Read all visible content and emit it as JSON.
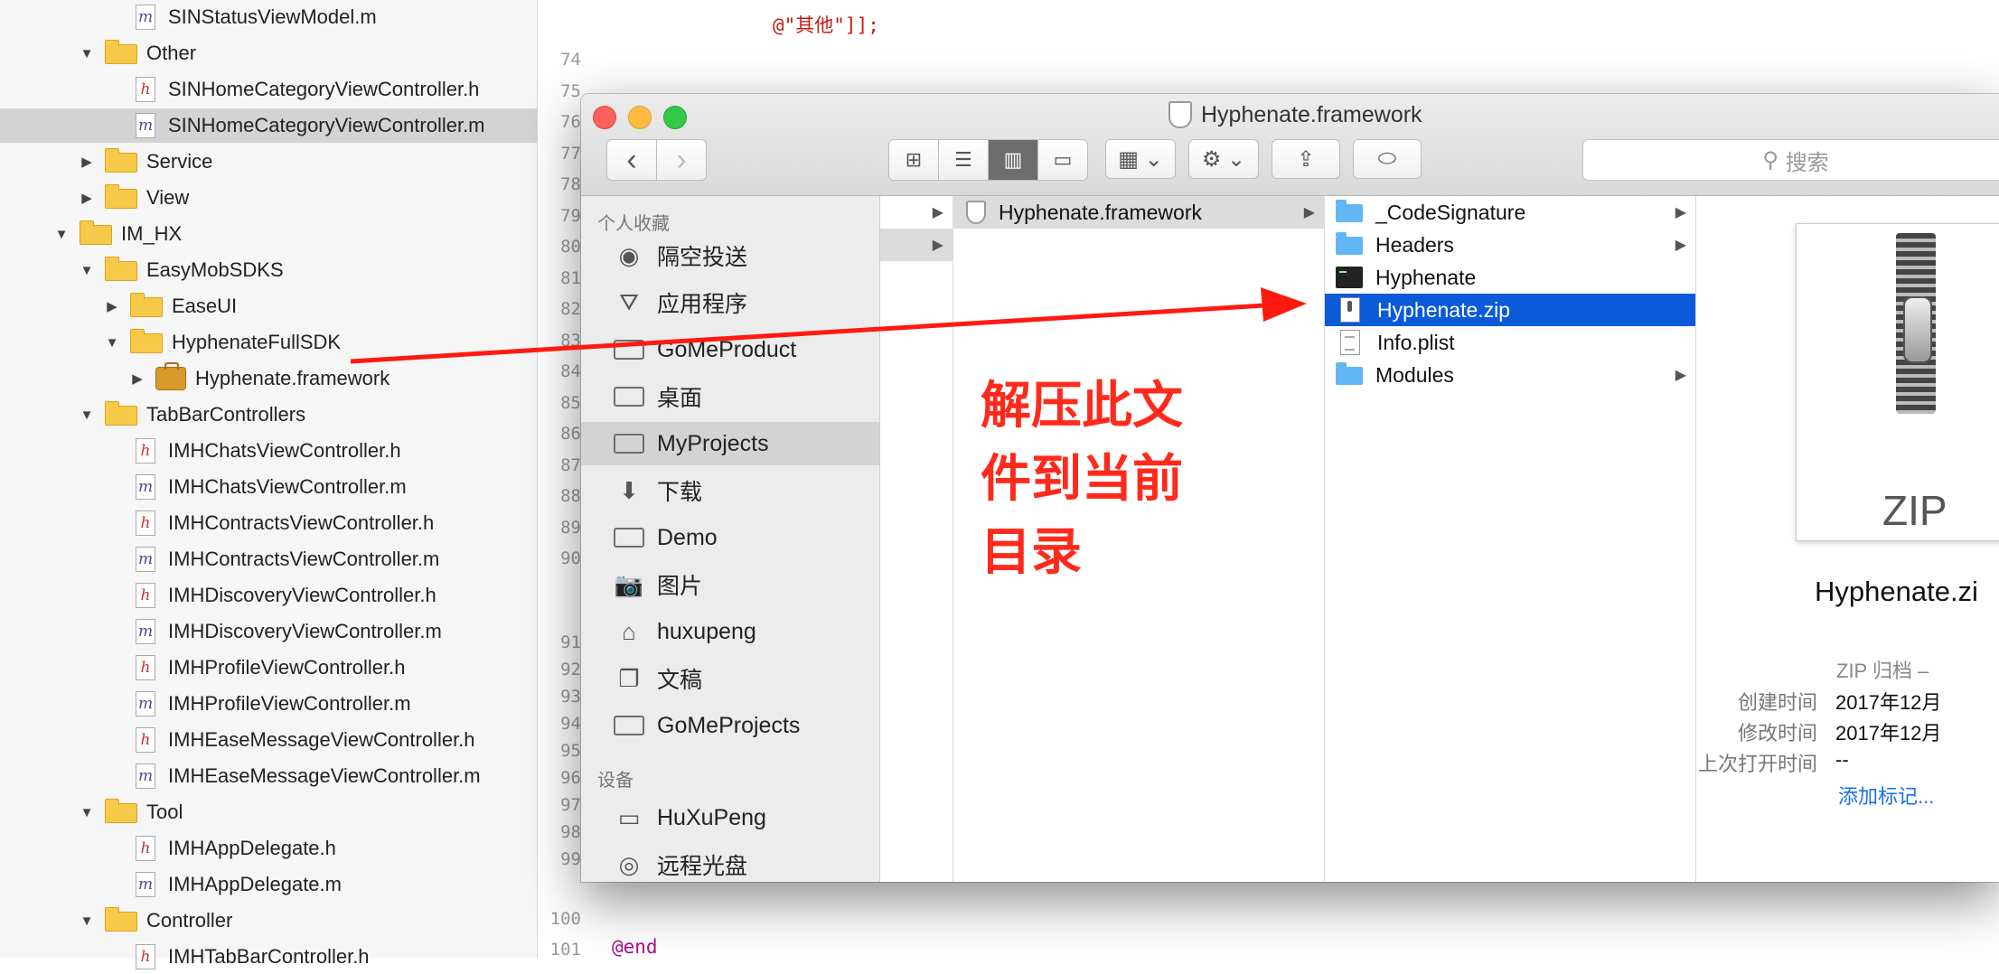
{
  "navigator": {
    "rows": [
      {
        "label": "SINStatusViewModel.m",
        "kind": "m",
        "disc": ""
      },
      {
        "label": "Other",
        "kind": "folder",
        "disc": "▼"
      },
      {
        "label": "SINHomeCategoryViewController.h",
        "kind": "h",
        "disc": ""
      },
      {
        "label": "SINHomeCategoryViewController.m",
        "kind": "m",
        "disc": "",
        "selected": true
      },
      {
        "label": "Service",
        "kind": "folder",
        "disc": "▶"
      },
      {
        "label": "View",
        "kind": "folder",
        "disc": "▶"
      },
      {
        "label": "IM_HX",
        "kind": "folder",
        "disc": "▼"
      },
      {
        "label": "EasyMobSDKS",
        "kind": "folder",
        "disc": "▼"
      },
      {
        "label": "EaseUI",
        "kind": "folder",
        "disc": "▶"
      },
      {
        "label": "HyphenateFullSDK",
        "kind": "folder",
        "disc": "▼"
      },
      {
        "label": "Hyphenate.framework",
        "kind": "fw",
        "disc": "▶"
      },
      {
        "label": "TabBarControllers",
        "kind": "folder",
        "disc": "▼"
      },
      {
        "label": "IMHChatsViewController.h",
        "kind": "h",
        "disc": ""
      },
      {
        "label": "IMHChatsViewController.m",
        "kind": "m",
        "disc": ""
      },
      {
        "label": "IMHContractsViewController.h",
        "kind": "h",
        "disc": ""
      },
      {
        "label": "IMHContractsViewController.m",
        "kind": "m",
        "disc": ""
      },
      {
        "label": "IMHDiscoveryViewController.h",
        "kind": "h",
        "disc": ""
      },
      {
        "label": "IMHDiscoveryViewController.m",
        "kind": "m",
        "disc": ""
      },
      {
        "label": "IMHProfileViewController.h",
        "kind": "h",
        "disc": ""
      },
      {
        "label": "IMHProfileViewController.m",
        "kind": "m",
        "disc": ""
      },
      {
        "label": "IMHEaseMessageViewController.h",
        "kind": "h",
        "disc": ""
      },
      {
        "label": "IMHEaseMessageViewController.m",
        "kind": "m",
        "disc": ""
      },
      {
        "label": "Tool",
        "kind": "folder",
        "disc": "▼"
      },
      {
        "label": "IMHAppDelegate.h",
        "kind": "h",
        "disc": ""
      },
      {
        "label": "IMHAppDelegate.m",
        "kind": "m",
        "disc": ""
      },
      {
        "label": "Controller",
        "kind": "folder",
        "disc": "▼"
      },
      {
        "label": "IMHTabBarController.h",
        "kind": "h",
        "disc": ""
      }
    ]
  },
  "editor": {
    "code_top": "@\"其他\"]];",
    "code_end": "@end",
    "line_numbers": [
      "74",
      "75",
      "76",
      "77",
      "78",
      "79",
      "80",
      "81",
      "82",
      "83",
      "84",
      "85",
      "86",
      "87",
      "88",
      "89",
      "90",
      "91",
      "92",
      "93",
      "94",
      "95",
      "96",
      "97",
      "98",
      "99",
      "100",
      "101"
    ]
  },
  "finder": {
    "title": "Hyphenate.framework",
    "search_placeholder": "搜索",
    "toolbar": {
      "back": "‹",
      "forward": "›",
      "view_icons": [
        "⊞",
        "☰",
        "▥",
        "▭"
      ],
      "group": "▦ ⌄",
      "action": "⚙ ⌄",
      "share": "⇪",
      "tag": "⬭"
    },
    "sidebar": {
      "favorites_header": "个人收藏",
      "favorites": [
        {
          "label": "隔空投送",
          "icon": "airdrop-icon",
          "glyph": "◉"
        },
        {
          "label": "应用程序",
          "icon": "applications-icon",
          "glyph": "⛛"
        },
        {
          "label": "GoMeProduct",
          "icon": "folder-icon",
          "glyph": ""
        },
        {
          "label": "桌面",
          "icon": "desktop-icon",
          "glyph": ""
        },
        {
          "label": "MyProjects",
          "icon": "folder-icon",
          "glyph": "",
          "selected": true
        },
        {
          "label": "下载",
          "icon": "download-icon",
          "glyph": "⬇"
        },
        {
          "label": "Demo",
          "icon": "folder-icon",
          "glyph": ""
        },
        {
          "label": "图片",
          "icon": "camera-icon",
          "glyph": "📷"
        },
        {
          "label": "huxupeng",
          "icon": "home-icon",
          "glyph": "⌂"
        },
        {
          "label": "文稿",
          "icon": "documents-icon",
          "glyph": "❐"
        },
        {
          "label": "GoMeProjects",
          "icon": "folder-icon",
          "glyph": ""
        }
      ],
      "devices_header": "设备",
      "devices": [
        {
          "label": "HuXuPeng",
          "icon": "laptop-icon",
          "glyph": "▭"
        },
        {
          "label": "远程光盘",
          "icon": "disc-icon",
          "glyph": "◎"
        }
      ]
    },
    "column1": {
      "items": [
        {
          "label": "",
          "arrow": "▶"
        },
        {
          "label": "",
          "arrow": "▶"
        }
      ]
    },
    "column2": {
      "items": [
        {
          "label": "Hyphenate.framework",
          "arrow": "▶"
        }
      ]
    },
    "column3": {
      "items": [
        {
          "label": "_CodeSignature",
          "icon": "bfolder",
          "arrow": "▶"
        },
        {
          "label": "Headers",
          "icon": "bfolder",
          "arrow": "▶"
        },
        {
          "label": "Hyphenate",
          "icon": "exec",
          "arrow": ""
        },
        {
          "label": "Hyphenate.zip",
          "icon": "zipdoc",
          "arrow": "",
          "selected": true
        },
        {
          "label": "Info.plist",
          "icon": "plist",
          "arrow": ""
        },
        {
          "label": "Modules",
          "icon": "bfolder",
          "arrow": "▶"
        }
      ]
    },
    "preview": {
      "zip_label": "ZIP",
      "file_name": "Hyphenate.zi",
      "kind": "ZIP 归档 –",
      "created_label": "创建时间",
      "created_value": "2017年12月",
      "modified_label": "修改时间",
      "modified_value": "2017年12月",
      "opened_label": "上次打开时间",
      "opened_value": "--",
      "add_tags": "添加标记..."
    }
  },
  "annotation": {
    "lines": [
      "解压此文",
      "件到当前",
      "目录"
    ],
    "color": "#ff2a1c"
  }
}
